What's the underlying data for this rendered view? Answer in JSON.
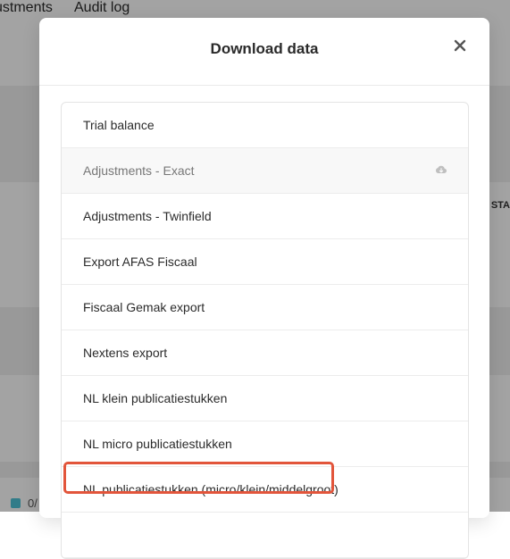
{
  "background": {
    "tabs": [
      "ustments",
      "Audit log"
    ],
    "right_label": "STA",
    "legend_text": "0/"
  },
  "modal": {
    "title": "Download data",
    "items": [
      {
        "label": "Trial balance"
      },
      {
        "label": "Adjustments - Exact",
        "disabled": true,
        "icon": "cloud-download-icon"
      },
      {
        "label": "Adjustments - Twinfield"
      },
      {
        "label": "Export AFAS Fiscaal"
      },
      {
        "label": "Fiscaal Gemak export"
      },
      {
        "label": "Nextens export"
      },
      {
        "label": "NL klein publicatiestukken"
      },
      {
        "label": "NL micro publicatiestukken"
      },
      {
        "label": "NL publicatiestukken (micro/klein/middelgroot)",
        "highlighted": true
      }
    ]
  },
  "colors": {
    "overlay": "rgba(0,0,0,0.36)",
    "highlight_border": "#e2553b",
    "legend_swatch": "#4fc3d7"
  }
}
